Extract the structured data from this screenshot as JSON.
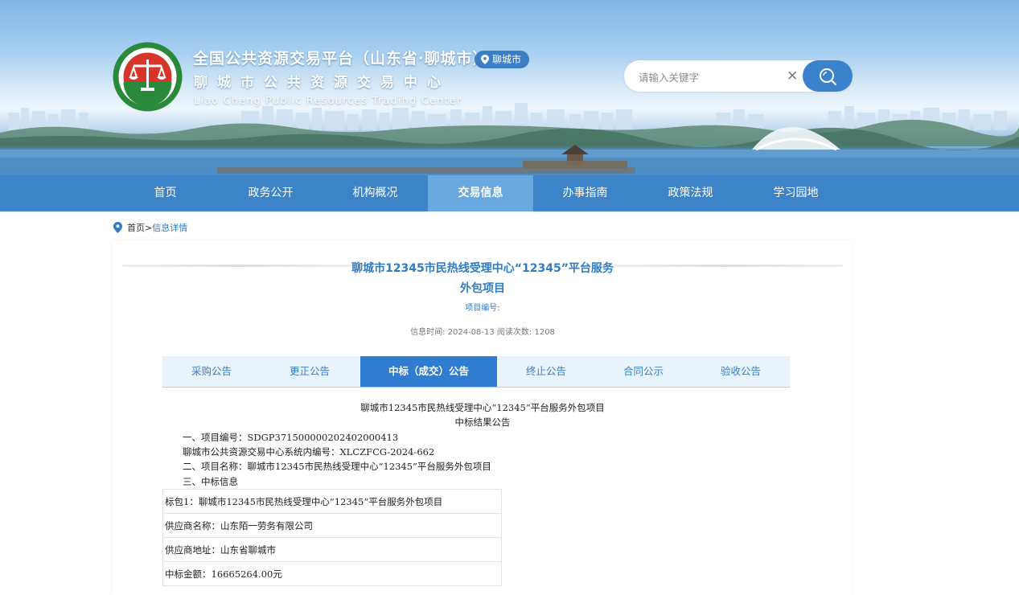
{
  "header": {
    "title_cn": "全国公共资源交易平台（山东省·聊城市）",
    "subtitle_cn": "聊城市公共资源交易中心",
    "subtitle_en": "Liao Cheng Public Resources Trading Center",
    "city_badge": "聊城市",
    "logo_ring_text": "聊城市公共资源交易中心",
    "search_placeholder": "请输入关键字",
    "search_clear": "×"
  },
  "nav": {
    "items": [
      {
        "label": "首页"
      },
      {
        "label": "政务公开"
      },
      {
        "label": "机构概况"
      },
      {
        "label": "交易信息"
      },
      {
        "label": "办事指南"
      },
      {
        "label": "政策法规"
      },
      {
        "label": "学习园地"
      }
    ],
    "active_index": 3
  },
  "breadcrumb": {
    "home": "首页",
    "separator": ">",
    "current": "信息详情"
  },
  "article": {
    "title_line1": "聊城市12345市民热线受理中心“12345”平台服务",
    "title_line2": "外包项目",
    "project_no_label": "项目编号:",
    "meta": "信息时间: 2024-08-13    阅读次数: 1208"
  },
  "tabs": {
    "items": [
      {
        "label": "采购公告"
      },
      {
        "label": "更正公告"
      },
      {
        "label": "中标（成交）公告"
      },
      {
        "label": "终止公告"
      },
      {
        "label": "合同公示"
      },
      {
        "label": "验收公告"
      }
    ],
    "active_index": 2
  },
  "document": {
    "title_line1": "聊城市12345市民热线受理中心“12345”平台服务外包项目",
    "title_line2": "中标结果公告",
    "lines": [
      "一、项目编号：SDGP371500000202402000413",
      "聊城市公共资源交易中心系统内编号：XLCZFCG-2024-662",
      "二、项目名称：聊城市12345市民热线受理中心“12345”平台服务外包项目",
      "三、中标信息"
    ],
    "table": [
      "标包1：聊城市12345市民热线受理中心“12345”平台服务外包项目",
      "供应商名称：山东陌一劳务有限公司",
      "供应商地址：山东省聊城市",
      "中标金额：16665264.00元"
    ]
  },
  "colors": {
    "nav_bg": "#3c83c8",
    "nav_active": "#6aa8e0",
    "accent": "#2f7cc4",
    "tab_active": "#2f7cd0",
    "tab_bg": "#e9f3fc",
    "logo_red": "#d8352a",
    "logo_green": "#2a8a3c"
  },
  "icons": {
    "logo": "balance-scale-emblem",
    "city_badge": "map-pin-icon",
    "search": "search-icon",
    "breadcrumb": "location-pin-icon"
  }
}
